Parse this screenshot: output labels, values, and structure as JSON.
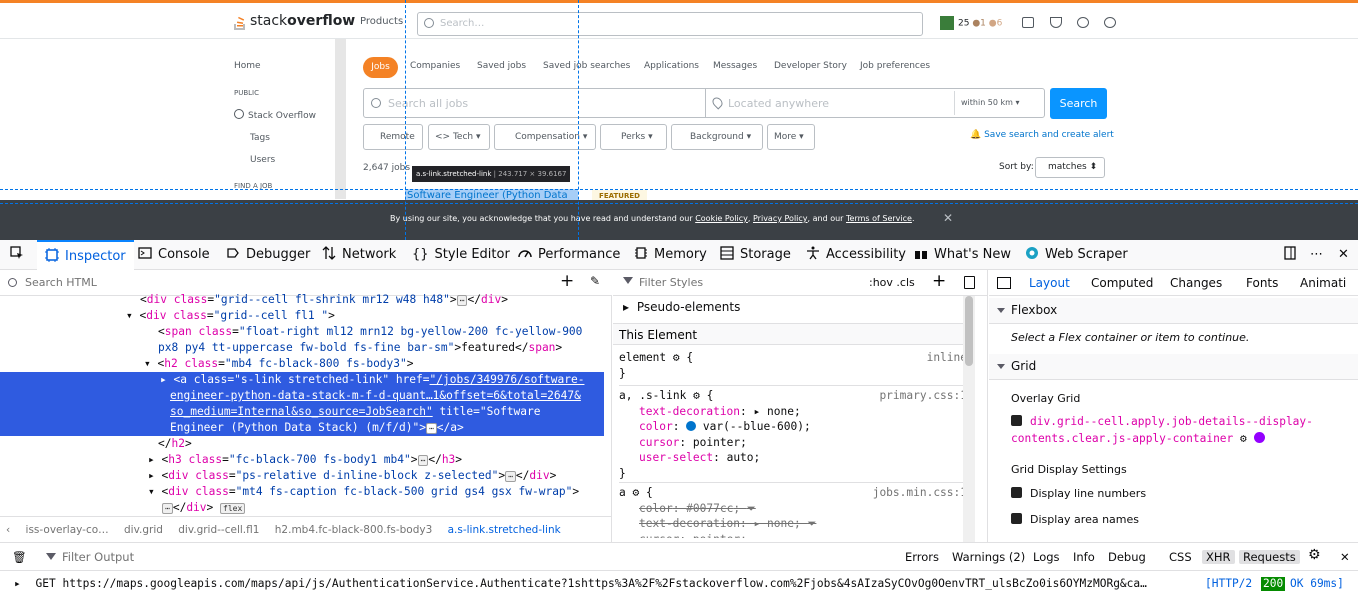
{
  "site": {
    "logo_plain": "stack",
    "logo_bold": "overflow",
    "products": "Products",
    "search_placeholder": "Search…",
    "rep": "25",
    "badge_silver": "●1",
    "badge_bronze": "●6"
  },
  "leftnav": {
    "home": "Home",
    "public": "PUBLIC",
    "stackoverflow": "Stack Overflow",
    "tags": "Tags",
    "users": "Users",
    "find_a_job": "FIND A JOB"
  },
  "jobtabs": [
    "Jobs",
    "Companies",
    "Saved jobs",
    "Saved job searches",
    "Applications",
    "Messages",
    "Developer Story",
    "Job preferences"
  ],
  "jobsearch": {
    "placeholder": "Search all jobs",
    "location_placeholder": "Located anywhere",
    "radius": "within 50 km",
    "button": "Search"
  },
  "filters": [
    "Remote",
    "<> Tech",
    "Compensation",
    "Perks",
    "Background",
    "More"
  ],
  "alert": "Save search and create alert",
  "results_count": "2,647 jobs",
  "sort_label": "Sort by:",
  "sort_value": "matches",
  "tooltip": {
    "selector": "a.s-link.stretched-link",
    "dims": "243.717 × 39.6167"
  },
  "job_title": "Software Engineer (Python Data",
  "featured": "FEATURED",
  "cookie": {
    "prefix": "By using our site, you acknowledge that you have read and understand our ",
    "cookie_policy": "Cookie Policy",
    "sep1": ", ",
    "privacy_policy": "Privacy Policy",
    "sep2": ", and our ",
    "terms": "Terms of Service",
    "suffix": ".",
    "close": "✕"
  },
  "devtools_tabs": [
    "Inspector",
    "Console",
    "Debugger",
    "Network",
    "Style Editor",
    "Performance",
    "Memory",
    "Storage",
    "Accessibility",
    "What's New",
    "Web Scraper"
  ],
  "inspector": {
    "search_placeholder": "Search HTML",
    "lines": [
      {
        "pre": "  <",
        "tag": "div",
        "attrs": [
          {
            "n": "class",
            "v": "grid--cell fl-shrink mr12 w48 h48"
          }
        ],
        "post": ">",
        "badge": "⋯",
        "close": "</div>"
      },
      {
        "pre": "▾ <",
        "tag": "div",
        "attrs": [
          {
            "n": "class",
            "v": "grid--cell fl1 "
          }
        ],
        "post": ">",
        "badge": "",
        "close": ""
      },
      {
        "pre": "    <",
        "tag": "span",
        "attrs": [
          {
            "n": "class",
            "v": "float-right ml12 mrn12 bg-yellow-200 fc-yellow-900"
          }
        ],
        "post": "",
        "badge": "",
        "close": ""
      },
      {
        "pre": "    px8 py4 tt-uppercase fw-bold fs-fine bar-sm\">featured</",
        "tag": "span",
        "attrs": [],
        "post": ">",
        "badge": "",
        "close": ""
      },
      {
        "pre": "  ▾ <",
        "tag": "h2",
        "attrs": [
          {
            "n": "class",
            "v": "mb4 fc-black-800 fs-body3"
          }
        ],
        "post": ">",
        "badge": "",
        "close": ""
      }
    ],
    "selected_lines": [
      "    ▸ <a class=\"s-link stretched-link\" href=\"/jobs/349976/software-",
      "      engineer-python-data-stack-m-f-d-quant…1&offset=6&total=2647&",
      "      so_medium=Internal&so_source=JobSearch\" title=\"Software",
      "      Engineer (Python Data Stack) (m/f/d)\">⋯</a>"
    ],
    "after_lines": [
      "    </h2>",
      "  ▸ <h3 class=\"fc-black-700 fs-body1 mb4\">⋯</h3>",
      "  ▸ <div class=\"ps-relative d-inline-block z-selected\">⋯</div>",
      "  ▾ <div class=\"mt4 fs-caption fc-black-500 grid gs4 gsx fw-wrap\">",
      "      ⋯</div> flex"
    ],
    "breadcrumbs": [
      "iss-overlay-co…",
      "div.grid",
      "div.grid--cell.fl1",
      "h2.mb4.fc-black-800.fs-body3",
      "a.s-link.stretched-link"
    ]
  },
  "rules": {
    "filter_placeholder": "Filter Styles",
    "hov": ":hov",
    "cls": ".cls",
    "pseudo": "Pseudo-elements",
    "this_element": "This Element",
    "element_sel": "element",
    "element_src": "inline",
    "r1_sel": "a, .s-link",
    "r1_src": "primary.css:1",
    "r1_props": [
      {
        "n": "text-decoration",
        "v": "none"
      },
      {
        "n": "color",
        "v": "var(--blue-600)"
      },
      {
        "n": "cursor",
        "v": "pointer"
      },
      {
        "n": "user-select",
        "v": "auto"
      }
    ],
    "r2_sel": "a",
    "r2_src": "jobs.min.css:1",
    "r2_props": [
      {
        "n": "color",
        "v": "#0077cc"
      },
      {
        "n": "text-decoration",
        "v": "none"
      },
      {
        "n": "cursor",
        "v": "pointer"
      }
    ]
  },
  "layout": {
    "tabs": [
      "Layout",
      "Computed",
      "Changes",
      "Fonts",
      "Animati"
    ],
    "flexbox": "Flexbox",
    "flex_msg": "Select a Flex container or item to continue.",
    "grid": "Grid",
    "overlay_grid": "Overlay Grid",
    "grid_item": "div.grid--cell.apply.job-details--display-",
    "grid_item2": "contents.clear.js-apply-container",
    "display_settings": "Grid Display Settings",
    "line_numbers": "Display line numbers",
    "area_names": "Display area names"
  },
  "console": {
    "filter_placeholder": "Filter Output",
    "filters": [
      "Errors",
      "Warnings (2)",
      "Logs",
      "Info",
      "Debug",
      "CSS",
      "XHR",
      "Requests"
    ],
    "method": "GET",
    "url": "https://maps.googleapis.com/maps/api/js/AuthenticationService.Authenticate?1shttps%3A%2F%2Fstackoverflow.com%2Fjobs&4sAIzaSyCOvOg0OenvTRT_ulsBcZo0is6OYMzMORg&ca…",
    "http": "[HTTP/2",
    "status": "200",
    "status_text": "OK 69ms]"
  },
  "colors": {
    "accent": "#0a84ff",
    "selected_row": "#2f5be0",
    "so_orange": "#f48225",
    "so_blue": "#0a95ff"
  }
}
